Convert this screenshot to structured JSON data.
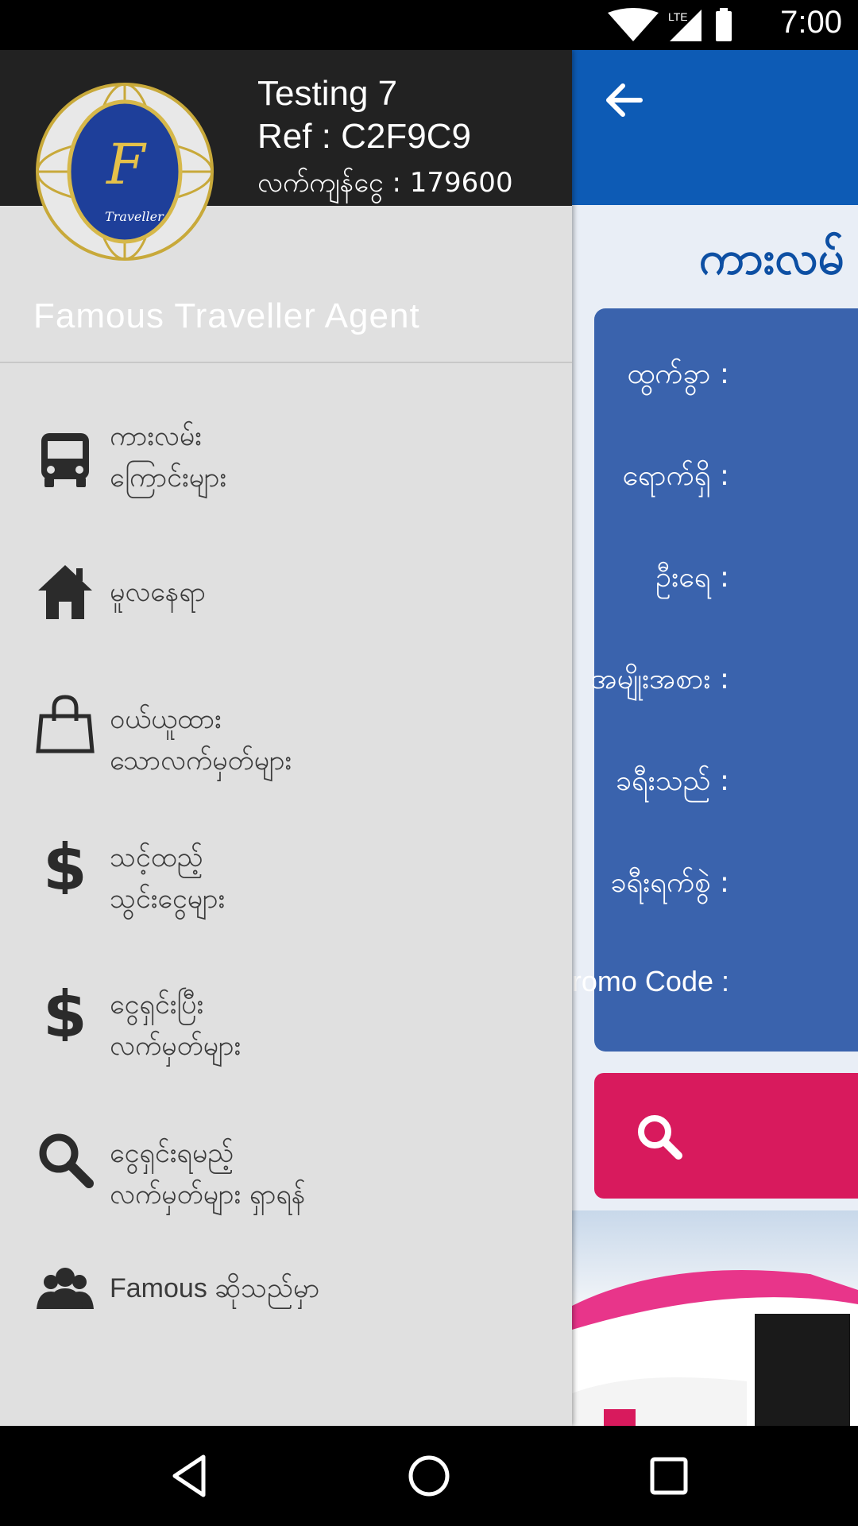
{
  "status": {
    "time": "7:00",
    "network": "LTE"
  },
  "user": {
    "name": "Testing 7",
    "ref": "Ref : C2F9C9",
    "balance": "လက်ကျန်ငွေ : 179600"
  },
  "agent_name": "Famous Traveller Agent",
  "logo_text": "Traveller",
  "menu": [
    {
      "icon": "bus-icon",
      "label": "ကားလမ်း\nကြောင်းများ"
    },
    {
      "icon": "home-icon",
      "label": "မူလနေရာ"
    },
    {
      "icon": "shopping-bag-icon",
      "label": "ဝယ်ယူထား\nသောလက်မှတ်များ"
    },
    {
      "icon": "dollar-icon",
      "label": "သင့်ထည့်\nသွင်းငွေများ"
    },
    {
      "icon": "dollar-icon",
      "label": "ငွေရှင်းပြီး\nလက်မှတ်များ"
    },
    {
      "icon": "search-icon",
      "label": "ငွေရှင်းရမည့်\nလက်မှတ်များ ရှာရန်"
    },
    {
      "icon": "group-icon",
      "label": "Famous ဆိုသည်မှာ"
    }
  ],
  "background": {
    "title": "ကားလမ်",
    "form_fields": [
      "ထွက်ခွာ :",
      "ရောက်ရှိ :",
      "ဦးရေ :",
      "အမျိုးအစား :",
      "ခရီးသည် :",
      "ခရီးရက်စွဲ :",
      "Promo Code :"
    ]
  },
  "colors": {
    "toolbar": "#0d5bb5",
    "form_card": "#3a63ad",
    "search_button": "#d81a5d",
    "drawer": "#e0e0e0",
    "drawer_header": "#222222"
  }
}
